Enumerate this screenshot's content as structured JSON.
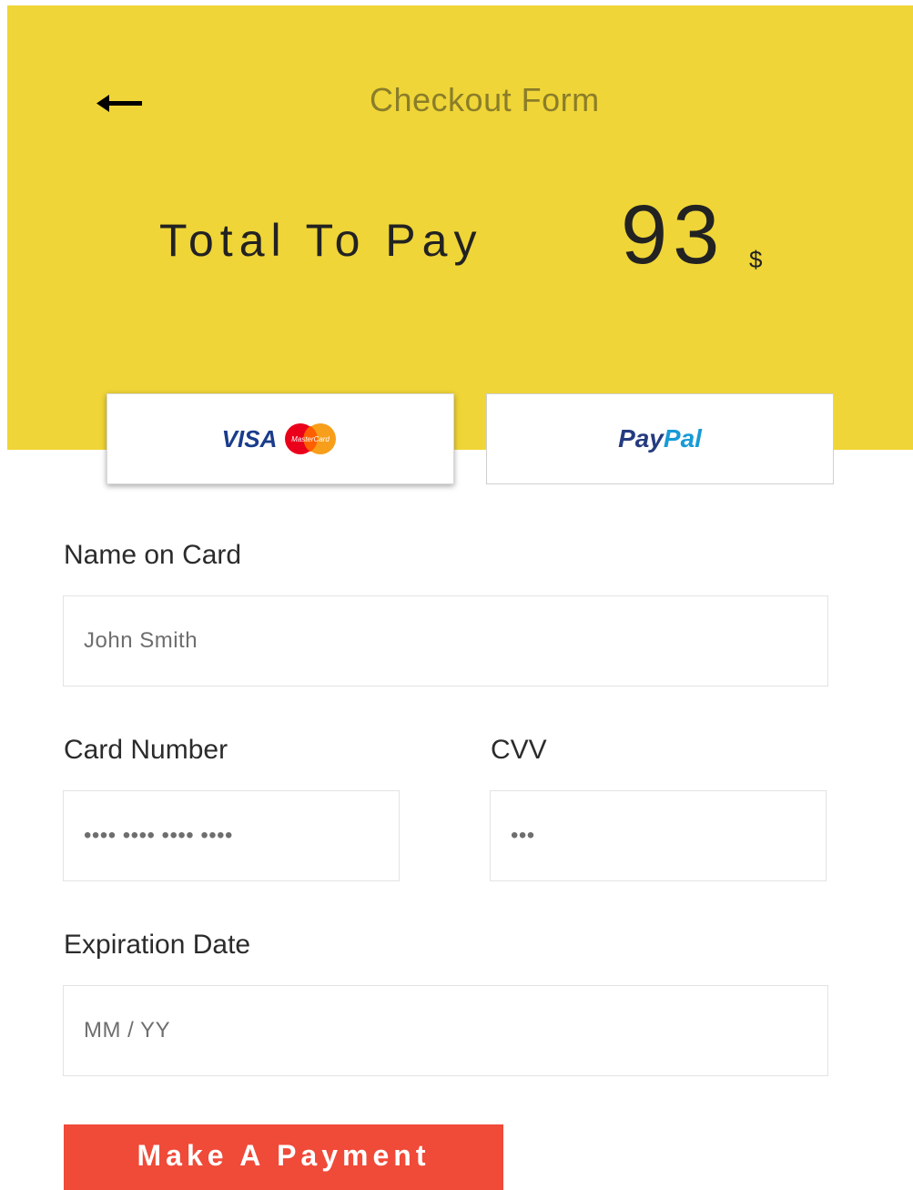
{
  "header": {
    "title": "Checkout Form",
    "total_label": "Total To Pay",
    "total_amount": "93",
    "currency": "$",
    "background_color": "#efd537"
  },
  "payment_methods": [
    {
      "id": "card",
      "visa_label": "VISA",
      "mastercard_label": "MasterCard",
      "selected": true
    },
    {
      "id": "paypal",
      "label_part1": "Pay",
      "label_part2": "Pal",
      "selected": false
    }
  ],
  "form": {
    "name": {
      "label": "Name on Card",
      "placeholder": "John Smith"
    },
    "card_number": {
      "label": "Card Number",
      "placeholder": "•••• •••• •••• ••••"
    },
    "cvv": {
      "label": "CVV",
      "placeholder": "•••"
    },
    "expiration": {
      "label": "Expiration Date",
      "placeholder": "MM / YY"
    }
  },
  "submit": {
    "label": "Make A Payment",
    "color": "#f04a38"
  },
  "icons": {
    "back": "arrow-left-icon"
  }
}
